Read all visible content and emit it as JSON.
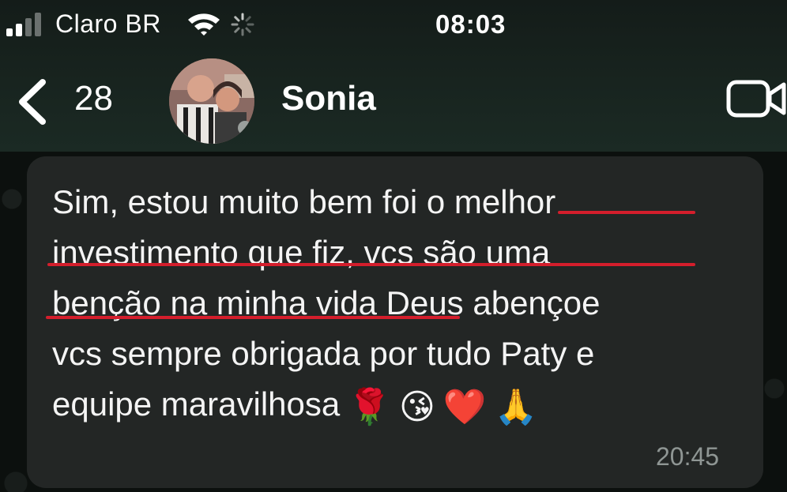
{
  "status_bar": {
    "carrier": "Claro BR",
    "time": "08:03",
    "signal_bars_filled": 2,
    "signal_bars_total": 4
  },
  "header": {
    "unread_count": "28",
    "contact_name": "Sonia",
    "icons": [
      "back-chevron-icon",
      "avatar-photo",
      "video-call-icon"
    ]
  },
  "message": {
    "line1_plain": "Sim, estou muito bem foi o ",
    "line1_marked": "melhor",
    "line2_marked": "investimento que fiz, vcs são uma",
    "line3_marked": "benção na minha vida",
    "line3_plain": " Deus abençoe",
    "line4": "vcs sempre obrigada por tudo Paty e",
    "line5": "equipe maravilhosa",
    "emojis": [
      "🌹",
      "😘",
      "❤️",
      "🙏"
    ],
    "time": "20:45"
  },
  "colors": {
    "header_bg": "#18241f",
    "bubble_bg": "#232625",
    "underline": "#d41e2c",
    "timestamp": "#8f9694"
  }
}
